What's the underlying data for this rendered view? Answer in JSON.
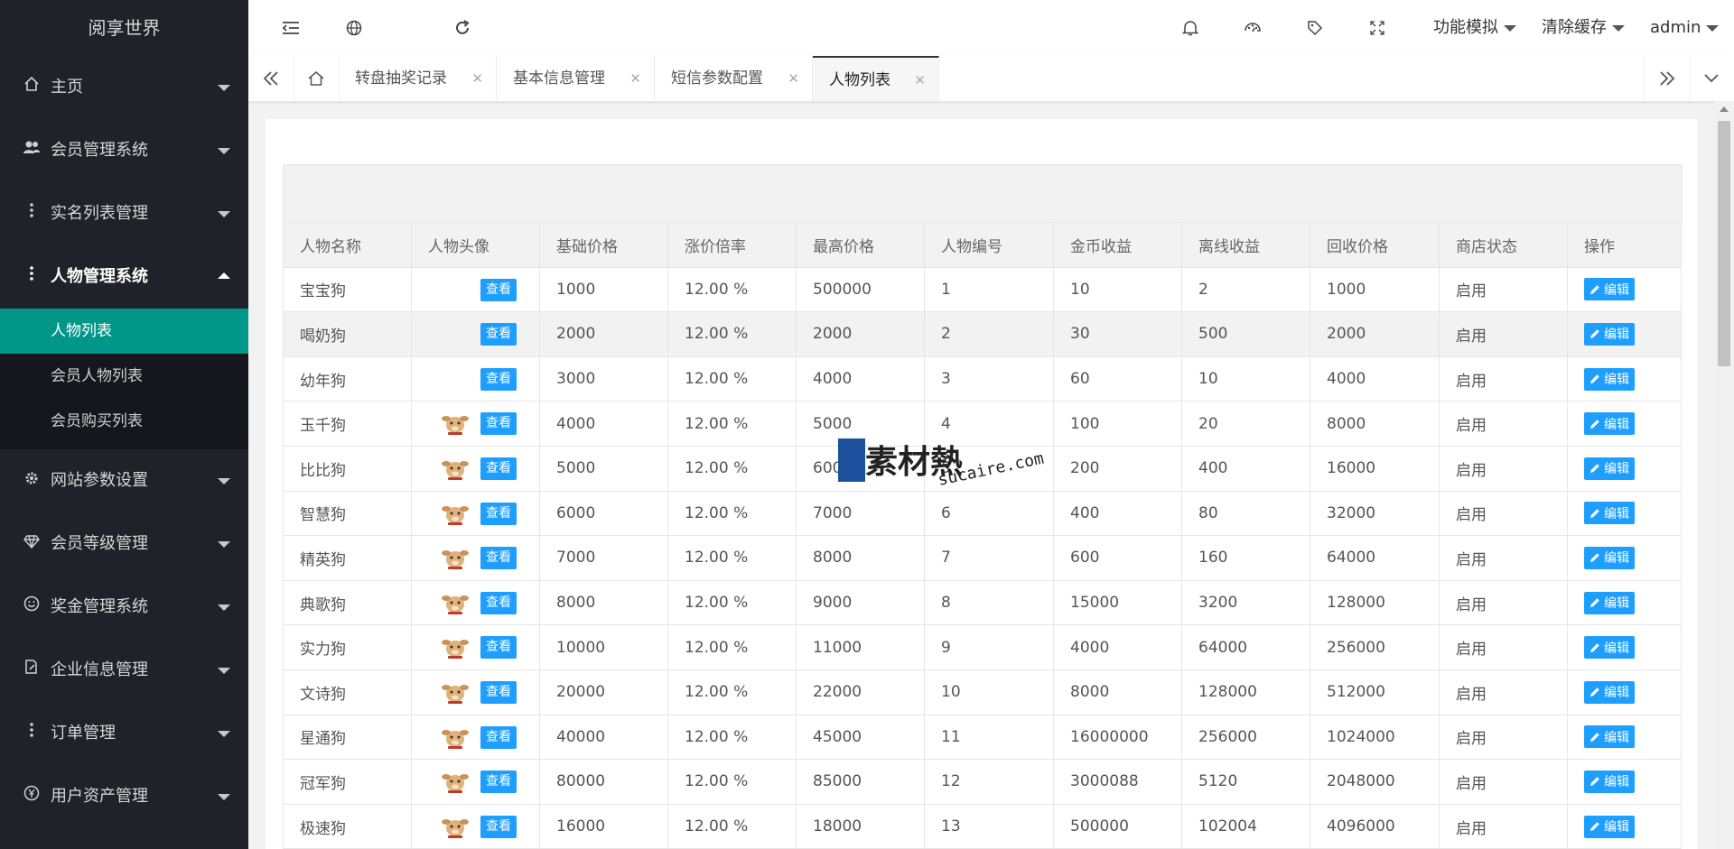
{
  "app": {
    "title": "阅享世界"
  },
  "sidebar": {
    "items": [
      {
        "label": "主页",
        "icon": "home-icon",
        "state": "collapsed"
      },
      {
        "label": "会员管理系统",
        "icon": "users-icon",
        "state": "collapsed"
      },
      {
        "label": "实名列表管理",
        "icon": "dots-icon",
        "state": "collapsed"
      },
      {
        "label": "人物管理系统",
        "icon": "dots-icon",
        "state": "expanded",
        "children": [
          {
            "label": "人物列表",
            "active": true
          },
          {
            "label": "会员人物列表"
          },
          {
            "label": "会员购买列表"
          }
        ]
      },
      {
        "label": "网站参数设置",
        "icon": "gear-icon",
        "state": "collapsed"
      },
      {
        "label": "会员等级管理",
        "icon": "diamond-icon",
        "state": "collapsed"
      },
      {
        "label": "奖金管理系统",
        "icon": "smile-icon",
        "state": "collapsed"
      },
      {
        "label": "企业信息管理",
        "icon": "edit-doc-icon",
        "state": "collapsed"
      },
      {
        "label": "订单管理",
        "icon": "dots-icon",
        "state": "collapsed"
      },
      {
        "label": "用户资产管理",
        "icon": "yen-icon",
        "state": "collapsed"
      }
    ]
  },
  "header": {
    "menus": [
      {
        "label": "功能模拟"
      },
      {
        "label": "清除缓存"
      },
      {
        "label": "admin"
      }
    ]
  },
  "tabs": [
    {
      "label": "转盘抽奖记录"
    },
    {
      "label": "基本信息管理"
    },
    {
      "label": "短信参数配置"
    },
    {
      "label": "人物列表",
      "active": true
    }
  ],
  "table": {
    "columns": [
      "人物名称",
      "人物头像",
      "基础价格",
      "涨价倍率",
      "最高价格",
      "人物编号",
      "金币收益",
      "离线收益",
      "回收价格",
      "商店状态",
      "操作"
    ],
    "view_label": "查看",
    "edit_label": "编辑",
    "rows": [
      {
        "name": "宝宝狗",
        "avatar": false,
        "base": "1000",
        "rate": "12.00 %",
        "max": "500000",
        "no": "1",
        "gold": "10",
        "offline": "2",
        "recycle": "1000",
        "status": "启用"
      },
      {
        "name": "喝奶狗",
        "avatar": false,
        "base": "2000",
        "rate": "12.00 %",
        "max": "2000",
        "no": "2",
        "gold": "30",
        "offline": "500",
        "recycle": "2000",
        "status": "启用"
      },
      {
        "name": "幼年狗",
        "avatar": false,
        "base": "3000",
        "rate": "12.00 %",
        "max": "4000",
        "no": "3",
        "gold": "60",
        "offline": "10",
        "recycle": "4000",
        "status": "启用"
      },
      {
        "name": "玉千狗",
        "avatar": true,
        "base": "4000",
        "rate": "12.00 %",
        "max": "5000",
        "no": "4",
        "gold": "100",
        "offline": "20",
        "recycle": "8000",
        "status": "启用"
      },
      {
        "name": "比比狗",
        "avatar": true,
        "base": "5000",
        "rate": "12.00 %",
        "max": "6000",
        "no": "5",
        "gold": "200",
        "offline": "400",
        "recycle": "16000",
        "status": "启用"
      },
      {
        "name": "智慧狗",
        "avatar": true,
        "base": "6000",
        "rate": "12.00 %",
        "max": "7000",
        "no": "6",
        "gold": "400",
        "offline": "80",
        "recycle": "32000",
        "status": "启用"
      },
      {
        "name": "精英狗",
        "avatar": true,
        "base": "7000",
        "rate": "12.00 %",
        "max": "8000",
        "no": "7",
        "gold": "600",
        "offline": "160",
        "recycle": "64000",
        "status": "启用"
      },
      {
        "name": "典歌狗",
        "avatar": true,
        "base": "8000",
        "rate": "12.00 %",
        "max": "9000",
        "no": "8",
        "gold": "15000",
        "offline": "3200",
        "recycle": "128000",
        "status": "启用"
      },
      {
        "name": "实力狗",
        "avatar": true,
        "base": "10000",
        "rate": "12.00 %",
        "max": "11000",
        "no": "9",
        "gold": "4000",
        "offline": "64000",
        "recycle": "256000",
        "status": "启用"
      },
      {
        "name": "文诗狗",
        "avatar": true,
        "base": "20000",
        "rate": "12.00 %",
        "max": "22000",
        "no": "10",
        "gold": "8000",
        "offline": "128000",
        "recycle": "512000",
        "status": "启用"
      },
      {
        "name": "星通狗",
        "avatar": true,
        "base": "40000",
        "rate": "12.00 %",
        "max": "45000",
        "no": "11",
        "gold": "16000000",
        "offline": "256000",
        "recycle": "1024000",
        "status": "启用"
      },
      {
        "name": "冠军狗",
        "avatar": true,
        "base": "80000",
        "rate": "12.00 %",
        "max": "85000",
        "no": "12",
        "gold": "3000088",
        "offline": "5120",
        "recycle": "2048000",
        "status": "启用"
      },
      {
        "name": "极速狗",
        "avatar": true,
        "base": "16000",
        "rate": "12.00 %",
        "max": "18000",
        "no": "13",
        "gold": "500000",
        "offline": "102004",
        "recycle": "4096000",
        "status": "启用"
      }
    ]
  },
  "watermark": {
    "brand": "素材熱",
    "domain": "sucaire.com"
  },
  "colors": {
    "sidebar_bg": "#20222a",
    "active_green": "#009688",
    "button_blue": "#1e9fff"
  }
}
